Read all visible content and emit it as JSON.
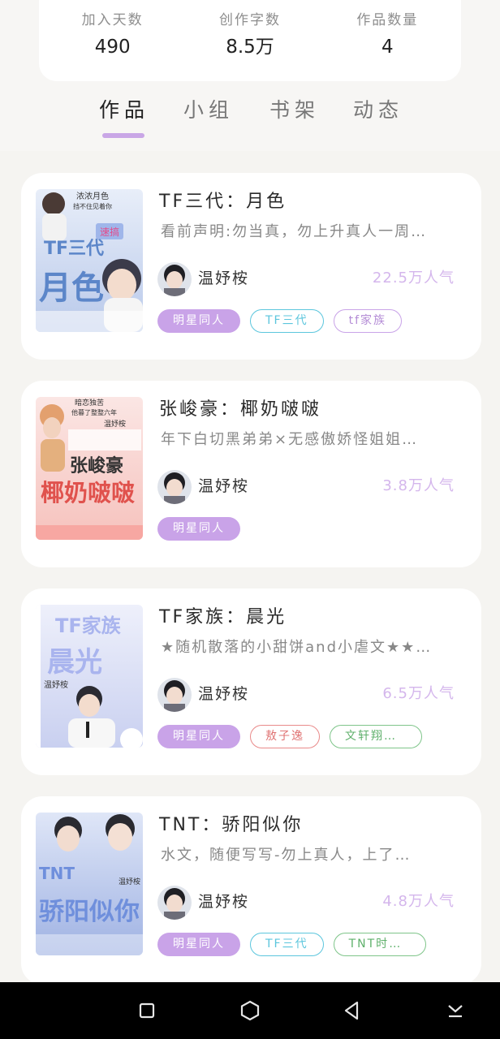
{
  "stats": [
    {
      "label": "加入天数",
      "value": "490"
    },
    {
      "label": "创作字数",
      "value": "8.5万"
    },
    {
      "label": "作品数量",
      "value": "4"
    }
  ],
  "tabs": [
    "作品",
    "小组",
    "书架",
    "动态"
  ],
  "active_tab": "作品",
  "books": [
    {
      "title": "TF三代：月色",
      "description": "看前声明:勿当真，勿上升真人一周…",
      "author": "温妤桉",
      "popularity": "22.5万人气",
      "tags": [
        "明星同人",
        "TF三代",
        "tf家族"
      ],
      "cover_text": [
        "浓浓月色",
        "挡不住见着你",
        "速搞",
        "TF三代",
        "月色"
      ]
    },
    {
      "title": "张峻豪：椰奶啵啵",
      "description": "年下白切黑弟弟×无感傲娇怪姐姐…",
      "author": "温妤桉",
      "popularity": "3.8万人气",
      "tags": [
        "明星同人"
      ],
      "cover_text": [
        "暗恋独苦",
        "他暮了整整六年",
        "温妤桉",
        "张峻豪",
        "椰奶啵啵"
      ]
    },
    {
      "title": "TF家族：晨光",
      "description": "★随机散落的小甜饼and小虐文★★…",
      "author": "温妤桉",
      "popularity": "6.5万人气",
      "tags": [
        "明星同人",
        "敖子逸",
        "文轩翔…"
      ],
      "cover_text": [
        "TF家族",
        "晨光",
        "温妤桉"
      ]
    },
    {
      "title": "TNT：骄阳似你",
      "description": "水文，随便写写-勿上真人，上了…",
      "author": "温妤桉",
      "popularity": "4.8万人气",
      "tags": [
        "明星同人",
        "TF三代",
        "TNT时代…"
      ],
      "cover_text": [
        "TNT",
        "骄阳似你",
        "温妤桉"
      ]
    }
  ],
  "nav": [
    "recent-apps",
    "home",
    "back",
    "notifications"
  ],
  "colors": {
    "accent": "#c9a3e8",
    "popularity": "#d4b6ec",
    "tag_cyan": "#5cc6dd",
    "tag_red": "#e07474",
    "tag_green": "#5fb06b",
    "background": "#f5f4f1"
  }
}
